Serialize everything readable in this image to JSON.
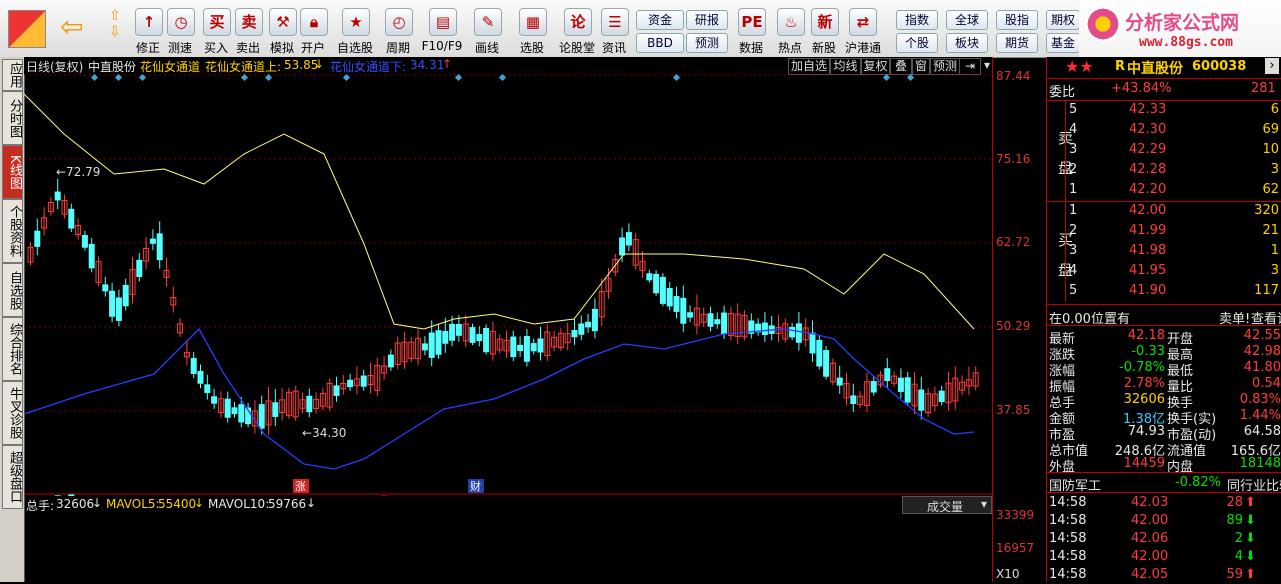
{
  "toolbar": {
    "items": [
      {
        "label": "修正",
        "icon": "up-arrow-icon"
      },
      {
        "label": "测速",
        "icon": "speed-icon"
      },
      {
        "label": "买入",
        "icon": "buy-icon"
      },
      {
        "label": "卖出",
        "icon": "sell-icon"
      },
      {
        "label": "模拟",
        "icon": "hammer-icon"
      },
      {
        "label": "开户",
        "icon": "lock-icon"
      },
      {
        "label": "自选股",
        "icon": "star-icon"
      },
      {
        "label": "周期",
        "icon": "clock-icon"
      },
      {
        "label": "F10/F9",
        "icon": "f10-icon"
      },
      {
        "label": "画线",
        "icon": "pen-icon"
      },
      {
        "label": "选股",
        "icon": "screen-icon"
      },
      {
        "label": "论股堂",
        "icon": "talk-icon"
      },
      {
        "label": "资讯",
        "icon": "news-icon"
      },
      {
        "label": "数据",
        "icon": "pe-icon"
      },
      {
        "label": "热点",
        "icon": "fire-icon"
      },
      {
        "label": "新股",
        "icon": "new-icon"
      },
      {
        "label": "沪港通",
        "icon": "hk-icon"
      }
    ],
    "small_buttons": [
      "资金",
      "研报",
      "BBD",
      "预测",
      "指数",
      "全球",
      "股指",
      "期权",
      "个股",
      "板块",
      "期货",
      "基金"
    ]
  },
  "logo": {
    "title": "分析家公式网",
    "url_text": "www.88gs.com"
  },
  "left_tabs": [
    "应用",
    "分时图",
    "K线图",
    "个股资料",
    "自选股",
    "综合排名",
    "牛叉诊股",
    "超级盘口"
  ],
  "chart": {
    "title": "日线(复权)",
    "stock": "中直股份",
    "indicator_name": "花仙女通道",
    "upper_label": "花仙女通道上:",
    "upper_value": "53.85",
    "lower_label": "花仙女通道下:",
    "lower_value": "34.31",
    "buttons": [
      "加自选",
      "均线",
      "复权",
      "叠",
      "窗",
      "预测"
    ],
    "high_marker": "72.79",
    "low_marker": "34.30",
    "event_zhang": "涨",
    "event_cai": "财",
    "price_axis": [
      "87.44",
      "75.16",
      "62.72",
      "50.29",
      "37.85"
    ],
    "volume_axis": [
      "33399",
      "16957",
      "X10"
    ]
  },
  "volume": {
    "total_label": "总手:",
    "total_value": "32606",
    "ma5_label": "MAVOL5:",
    "ma5_value": "55400",
    "ma10_label": "MAVOL10:",
    "ma10_value": "59766",
    "dropdown": "成交量"
  },
  "quote": {
    "name": "中直股份",
    "code": "600038",
    "prefix": "R",
    "wb_label": "委比",
    "wb_value": "+43.84%",
    "wb_diff": "281",
    "sell_label": "卖盘",
    "buy_label": "买盘",
    "asks": [
      {
        "lvl": "5",
        "price": "42.33",
        "vol": "6"
      },
      {
        "lvl": "4",
        "price": "42.30",
        "vol": "69"
      },
      {
        "lvl": "3",
        "price": "42.29",
        "vol": "10"
      },
      {
        "lvl": "2",
        "price": "42.28",
        "vol": "3"
      },
      {
        "lvl": "1",
        "price": "42.20",
        "vol": "62"
      }
    ],
    "bids": [
      {
        "lvl": "1",
        "price": "42.00",
        "vol": "320"
      },
      {
        "lvl": "2",
        "price": "41.99",
        "vol": "21"
      },
      {
        "lvl": "3",
        "price": "41.98",
        "vol": "1"
      },
      {
        "lvl": "4",
        "price": "41.95",
        "vol": "3"
      },
      {
        "lvl": "5",
        "price": "41.90",
        "vol": "117"
      }
    ],
    "position_text": "在0.00位置有",
    "position_link": "卖单!",
    "detail_link": "查看详细",
    "stats": [
      {
        "l1": "最新",
        "v1": "42.18",
        "l2": "开盘",
        "v2": "42.55"
      },
      {
        "l1": "涨跌",
        "v1": "-0.33",
        "l2": "最高",
        "v2": "42.98"
      },
      {
        "l1": "涨幅",
        "v1": "-0.78%",
        "l2": "最低",
        "v2": "41.80"
      },
      {
        "l1": "振幅",
        "v1": "2.78%",
        "l2": "量比",
        "v2": "0.54"
      },
      {
        "l1": "总手",
        "v1": "32606",
        "l2": "换手",
        "v2": "0.83%"
      },
      {
        "l1": "金额",
        "v1": "1.38亿",
        "l2": "换手(实)",
        "v2": "1.44%"
      },
      {
        "l1": "市盈",
        "v1": "74.93",
        "l2": "市盈(动)",
        "v2": "64.58"
      },
      {
        "l1": "总市值",
        "v1": "248.6亿",
        "l2": "流通值",
        "v2": "165.6亿"
      },
      {
        "l1": "外盘",
        "v1": "14459",
        "l2": "内盘",
        "v2": "18148"
      }
    ],
    "industry_name": "国防军工",
    "industry_pct": "-0.82%",
    "industry_btn": "同行业比较",
    "ticks": [
      {
        "time": "14:58",
        "price": "42.03",
        "vol": "28",
        "dir": "up"
      },
      {
        "time": "14:58",
        "price": "42.00",
        "vol": "89",
        "dir": "down"
      },
      {
        "time": "14:58",
        "price": "42.06",
        "vol": "2",
        "dir": "down"
      },
      {
        "time": "14:58",
        "price": "42.00",
        "vol": "4",
        "dir": "down"
      },
      {
        "time": "14:58",
        "price": "42.05",
        "vol": "59",
        "dir": "up"
      }
    ]
  },
  "colors": {
    "up": "#ff3b3b",
    "down": "#54ffff",
    "upper_band": "#ffff80",
    "lower_band": "#2a3cff",
    "diamond": "#3aa7d8"
  }
}
